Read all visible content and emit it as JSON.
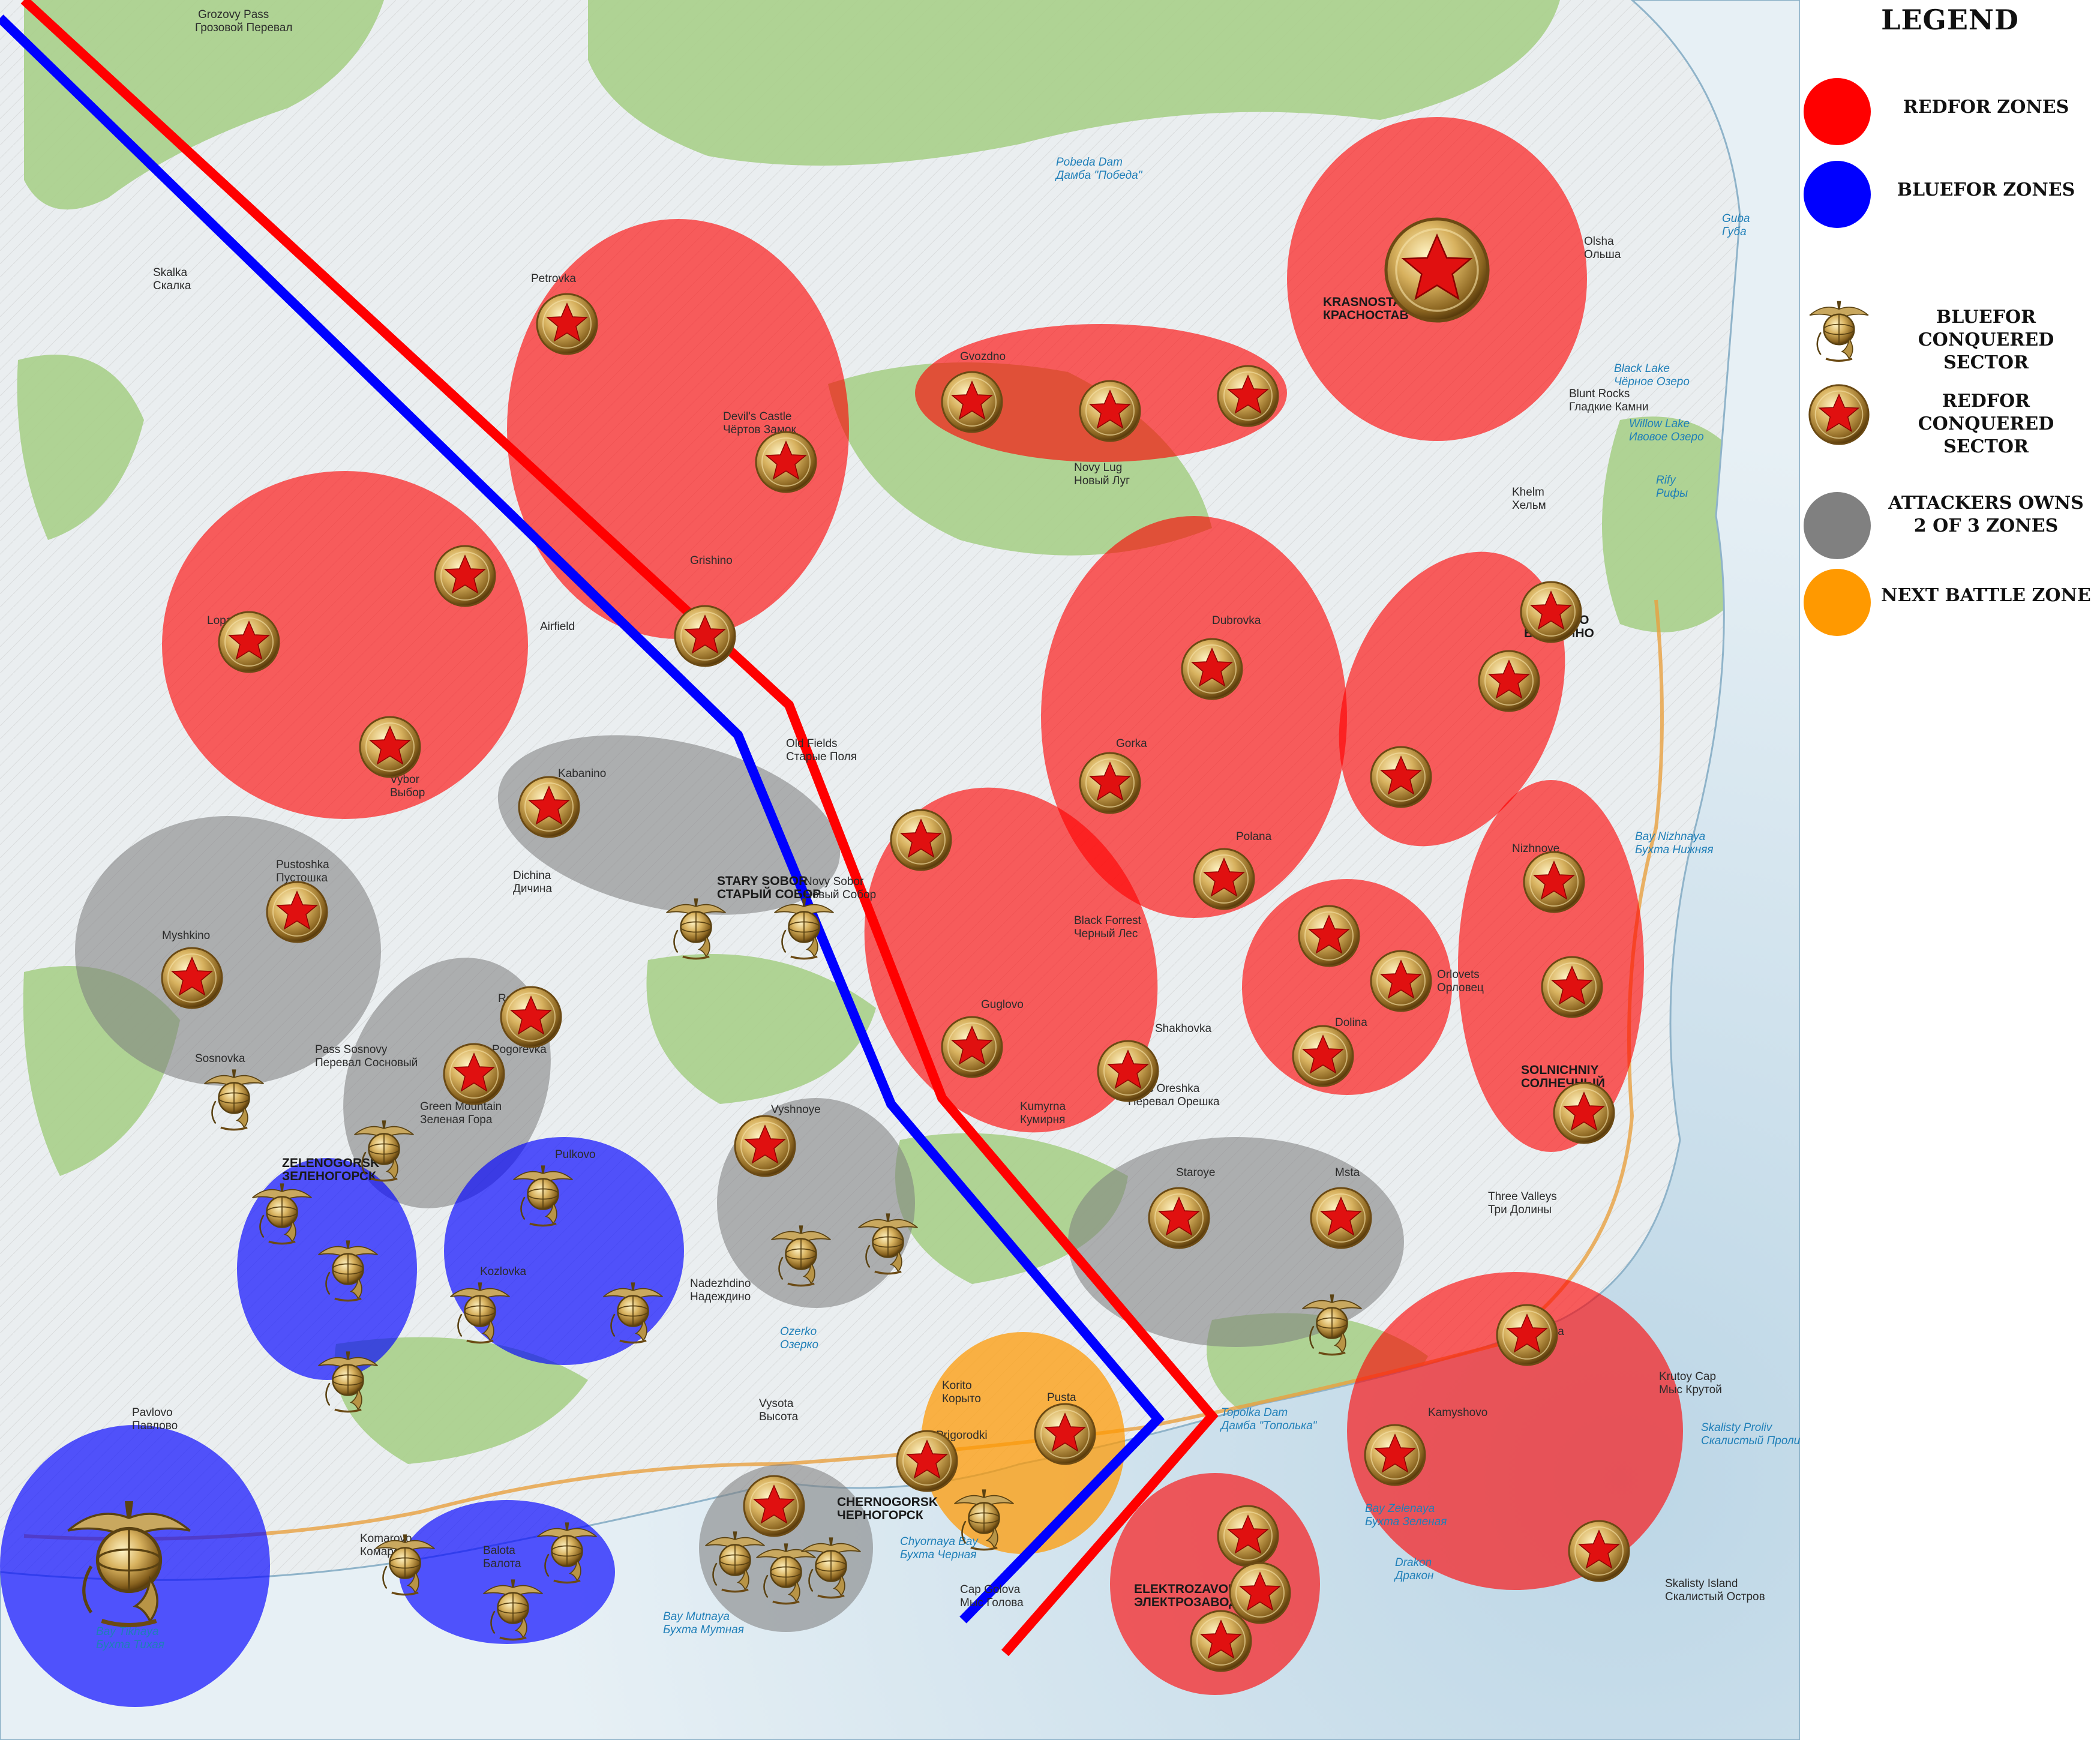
{
  "legend": {
    "title": "LEGEND",
    "items": [
      {
        "label": "REDFOR ZONES",
        "symbol": "red-zone-swatch",
        "color": "#ff0000"
      },
      {
        "label": "BLUEFOR ZONES",
        "symbol": "blue-zone-swatch",
        "color": "#0000ff"
      },
      {
        "label": "BLUEFOR\nCONQUERED SECTOR",
        "symbol": "usmc-emblem-icon"
      },
      {
        "label": "REDFOR\nCONQUERED SECTOR",
        "symbol": "red-star-medallion-icon"
      },
      {
        "label": "ATTACKERS OWNS\n2 OF 3 ZONES",
        "symbol": "gray-zone-swatch",
        "color": "#808080"
      },
      {
        "label": "NEXT BATTLE ZONE",
        "symbol": "orange-zone-swatch",
        "color": "#ff9900"
      }
    ]
  },
  "colors": {
    "redfor": "#ff0000",
    "bluefor": "#0000ff",
    "contested": "#808080",
    "next_battle": "#ff9900",
    "front_red": "#ff0000",
    "front_blue": "#0000ff"
  },
  "map": {
    "labels": [
      {
        "text": "Grozovy Pass",
        "kind": "normal"
      },
      {
        "text": "Грозовой Перевал",
        "kind": "normal"
      },
      {
        "text": "Skalka",
        "kind": "normal"
      },
      {
        "text": "Скалка",
        "kind": "normal"
      },
      {
        "text": "Petrovka",
        "kind": "normal"
      },
      {
        "text": "Devil's Castle",
        "kind": "normal"
      },
      {
        "text": "Чёртов Замок",
        "kind": "normal"
      },
      {
        "text": "Pobeda Dam",
        "kind": "water"
      },
      {
        "text": "Дамба \"Победа\"",
        "kind": "water"
      },
      {
        "text": "Gvozdno",
        "kind": "normal"
      },
      {
        "text": "Novy Lug",
        "kind": "normal"
      },
      {
        "text": "Новый Луг",
        "kind": "normal"
      },
      {
        "text": "KRASNOSTAV",
        "kind": "big"
      },
      {
        "text": "КРАСНОСТАВ",
        "kind": "big"
      },
      {
        "text": "Olsha",
        "kind": "normal"
      },
      {
        "text": "Ольша",
        "kind": "normal"
      },
      {
        "text": "Guba",
        "kind": "water"
      },
      {
        "text": "Губа",
        "kind": "water"
      },
      {
        "text": "Black Lake",
        "kind": "water"
      },
      {
        "text": "Чёрное Озеро",
        "kind": "water"
      },
      {
        "text": "Blunt Rocks",
        "kind": "normal"
      },
      {
        "text": "Гладкие Камни",
        "kind": "normal"
      },
      {
        "text": "Willow Lake",
        "kind": "water"
      },
      {
        "text": "Ивовое Озеро",
        "kind": "water"
      },
      {
        "text": "Rify",
        "kind": "water"
      },
      {
        "text": "Рифы",
        "kind": "water"
      },
      {
        "text": "Khelm",
        "kind": "normal"
      },
      {
        "text": "Хельм",
        "kind": "normal"
      },
      {
        "text": "Grishino",
        "kind": "normal"
      },
      {
        "text": "Airfield",
        "kind": "normal"
      },
      {
        "text": "Vybor",
        "kind": "normal"
      },
      {
        "text": "Выбор",
        "kind": "normal"
      },
      {
        "text": "Dubrovka",
        "kind": "normal"
      },
      {
        "text": "BEREZINO",
        "kind": "big"
      },
      {
        "text": "БЕРЕЗИНО",
        "kind": "big"
      },
      {
        "text": "Old Fields",
        "kind": "normal"
      },
      {
        "text": "Старые Поля",
        "kind": "normal"
      },
      {
        "text": "Gorka",
        "kind": "normal"
      },
      {
        "text": "Kabanino",
        "kind": "normal"
      },
      {
        "text": "Pustoshka",
        "kind": "normal"
      },
      {
        "text": "Пустошка",
        "kind": "normal"
      },
      {
        "text": "Dichina",
        "kind": "normal"
      },
      {
        "text": "Дичина",
        "kind": "normal"
      },
      {
        "text": "STARY SOBOR",
        "kind": "big"
      },
      {
        "text": "СТАРЫЙ СОБОР",
        "kind": "big"
      },
      {
        "text": "Polana",
        "kind": "normal"
      },
      {
        "text": "Nizhnoye",
        "kind": "normal"
      },
      {
        "text": "Bay Nizhnaya",
        "kind": "water"
      },
      {
        "text": "Бухта Нижняя",
        "kind": "water"
      },
      {
        "text": "Myshkino",
        "kind": "normal"
      },
      {
        "text": "Black Forrest",
        "kind": "normal"
      },
      {
        "text": "Черный Лес",
        "kind": "normal"
      },
      {
        "text": "Orlovets",
        "kind": "normal"
      },
      {
        "text": "Орловец",
        "kind": "normal"
      },
      {
        "text": "Pass Sosnovy",
        "kind": "normal"
      },
      {
        "text": "Перевал Сосновый",
        "kind": "normal"
      },
      {
        "text": "Sosnovka",
        "kind": "normal"
      },
      {
        "text": "Guglovo",
        "kind": "normal"
      },
      {
        "text": "Shakhovka",
        "kind": "normal"
      },
      {
        "text": "Dolina",
        "kind": "normal"
      },
      {
        "text": "SOLNICHNIY",
        "kind": "big"
      },
      {
        "text": "СОЛНЕЧНЫЙ",
        "kind": "big"
      },
      {
        "text": "Green Mountain",
        "kind": "normal"
      },
      {
        "text": "Зеленая Гора",
        "kind": "normal"
      },
      {
        "text": "Kumyrna",
        "kind": "normal"
      },
      {
        "text": "Кумирня",
        "kind": "normal"
      },
      {
        "text": "Vyshnoye",
        "kind": "normal"
      },
      {
        "text": "ZELENOGORSK",
        "kind": "big"
      },
      {
        "text": "ЗЕЛЕНОГОРСК",
        "kind": "big"
      },
      {
        "text": "Pulkovo",
        "kind": "normal"
      },
      {
        "text": "Staroye",
        "kind": "normal"
      },
      {
        "text": "Msta",
        "kind": "normal"
      },
      {
        "text": "Three Valleys",
        "kind": "normal"
      },
      {
        "text": "Три Долины",
        "kind": "normal"
      },
      {
        "text": "Kozlovka",
        "kind": "normal"
      },
      {
        "text": "Nadezhdino",
        "kind": "normal"
      },
      {
        "text": "Надеждино",
        "kind": "normal"
      },
      {
        "text": "Ozerko",
        "kind": "water"
      },
      {
        "text": "Озерко",
        "kind": "water"
      },
      {
        "text": "Tulga",
        "kind": "normal"
      },
      {
        "text": "Krutoy Cap",
        "kind": "normal"
      },
      {
        "text": "Мыс Крутой",
        "kind": "normal"
      },
      {
        "text": "Pavlovo",
        "kind": "normal"
      },
      {
        "text": "Павлово",
        "kind": "normal"
      },
      {
        "text": "Vysota",
        "kind": "normal"
      },
      {
        "text": "Высота",
        "kind": "normal"
      },
      {
        "text": "Kamyshovo",
        "kind": "normal"
      },
      {
        "text": "Skalisty Proliv",
        "kind": "water"
      },
      {
        "text": "Скалистый Пролив",
        "kind": "water"
      },
      {
        "text": "Komarovo",
        "kind": "normal"
      },
      {
        "text": "Комарово",
        "kind": "normal"
      },
      {
        "text": "Balota",
        "kind": "normal"
      },
      {
        "text": "Балота",
        "kind": "normal"
      },
      {
        "text": "CHERNOGORSK",
        "kind": "big"
      },
      {
        "text": "ЧЕРНОГОРСК",
        "kind": "big"
      },
      {
        "text": "Chyornaya Bay",
        "kind": "water"
      },
      {
        "text": "Бухта Черная",
        "kind": "water"
      },
      {
        "text": "Bay Zelenaya",
        "kind": "water"
      },
      {
        "text": "Бухта Зеленая",
        "kind": "water"
      },
      {
        "text": "Drakon",
        "kind": "water"
      },
      {
        "text": "Дракон",
        "kind": "water"
      },
      {
        "text": "Skalisty Island",
        "kind": "normal"
      },
      {
        "text": "Скалистый Остров",
        "kind": "normal"
      },
      {
        "text": "Cap Golova",
        "kind": "normal"
      },
      {
        "text": "Мыс Голова",
        "kind": "normal"
      },
      {
        "text": "ELEKTROZAVODSK",
        "kind": "big"
      },
      {
        "text": "ЭЛЕКТРОЗАВОДСК",
        "kind": "big"
      },
      {
        "text": "Bay Tikhaya",
        "kind": "water"
      },
      {
        "text": "Бухта Тихая",
        "kind": "water"
      },
      {
        "text": "Bay Mutnaya",
        "kind": "water"
      },
      {
        "text": "Бухта Мутная",
        "kind": "water"
      },
      {
        "text": "Topolka Dam",
        "kind": "water"
      },
      {
        "text": "Дамба \"Тополька\"",
        "kind": "water"
      },
      {
        "text": "Korito",
        "kind": "normal"
      },
      {
        "text": "Корыто",
        "kind": "normal"
      },
      {
        "text": "Prigorodki",
        "kind": "normal"
      },
      {
        "text": "Pusta",
        "kind": "normal"
      },
      {
        "text": "Rog",
        "kind": "normal"
      },
      {
        "text": "Pogorevka",
        "kind": "normal"
      },
      {
        "text": "Lopatino",
        "kind": "normal"
      },
      {
        "text": "Novy Sobor",
        "kind": "normal"
      },
      {
        "text": "Новый Собор",
        "kind": "normal"
      },
      {
        "text": "Pass Oreshka",
        "kind": "normal"
      },
      {
        "text": "Перевал Орешка",
        "kind": "normal"
      }
    ]
  }
}
